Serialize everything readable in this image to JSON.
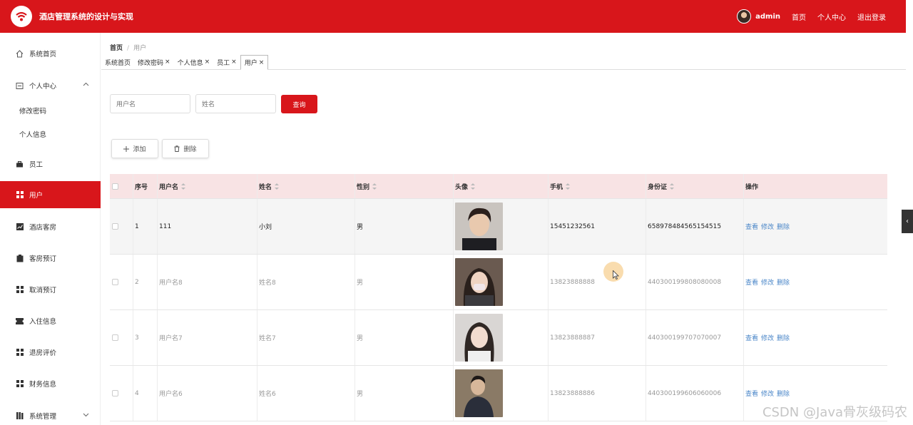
{
  "header": {
    "title": "酒店管理系统的设计与实现",
    "user": "admin",
    "links": [
      "首页",
      "个人中心",
      "退出登录"
    ],
    "accent": "#d8161b"
  },
  "sidebar": {
    "items": [
      {
        "label": "系统首页",
        "icon": "home-icon"
      },
      {
        "label": "个人中心",
        "icon": "profile-icon"
      },
      {
        "label": "修改密码"
      },
      {
        "label": "个人信息"
      },
      {
        "label": "员工",
        "icon": "briefcase-icon"
      },
      {
        "label": "用户",
        "icon": "grid-icon"
      },
      {
        "label": "酒店客房",
        "icon": "chart-icon"
      },
      {
        "label": "客房预订",
        "icon": "clipboard-icon"
      },
      {
        "label": "取消预订",
        "icon": "grid-icon"
      },
      {
        "label": "入住信息",
        "icon": "ticket-icon"
      },
      {
        "label": "退房评价",
        "icon": "grid-icon"
      },
      {
        "label": "财务信息",
        "icon": "grid-icon"
      },
      {
        "label": "系统管理",
        "icon": "library-icon"
      }
    ]
  },
  "breadcrumb": {
    "home": "首页",
    "current": "用户"
  },
  "tabs": [
    {
      "label": "系统首页"
    },
    {
      "label": "修改密码"
    },
    {
      "label": "个人信息"
    },
    {
      "label": "员工"
    },
    {
      "label": "用户"
    }
  ],
  "search": {
    "username_placeholder": "用户名",
    "name_placeholder": "姓名",
    "button": "查询"
  },
  "actions": {
    "add": "添加",
    "delete": "删除"
  },
  "table": {
    "headers": [
      "序号",
      "用户名",
      "姓名",
      "性别",
      "头像",
      "手机",
      "身份证",
      "操作"
    ],
    "ops": [
      "查看",
      "修改",
      "删除"
    ],
    "rows": [
      {
        "no": "1",
        "username": "111",
        "name": "小刘",
        "gender": "男",
        "phone": "15451232561",
        "id_card": "658978484565154515"
      },
      {
        "no": "2",
        "username": "用户名8",
        "name": "姓名8",
        "gender": "男",
        "phone": "13823888888",
        "id_card": "440300199808080008"
      },
      {
        "no": "3",
        "username": "用户名7",
        "name": "姓名7",
        "gender": "男",
        "phone": "13823888887",
        "id_card": "440300199707070007"
      },
      {
        "no": "4",
        "username": "用户名6",
        "name": "姓名6",
        "gender": "男",
        "phone": "13823888886",
        "id_card": "440300199606060006"
      }
    ]
  },
  "watermark": "CSDN @Java骨灰级码农"
}
